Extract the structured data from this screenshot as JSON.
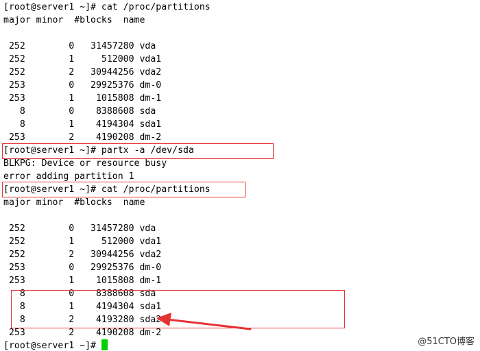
{
  "terminal": {
    "lines": [
      "[root@server1 ~]# cat /proc/partitions",
      "major minor  #blocks  name",
      "",
      " 252        0   31457280 vda",
      " 252        1     512000 vda1",
      " 252        2   30944256 vda2",
      " 253        0   29925376 dm-0",
      " 253        1    1015808 dm-1",
      "   8        0    8388608 sda",
      "   8        1    4194304 sda1",
      " 253        2    4190208 dm-2",
      "[root@server1 ~]# partx -a /dev/sda",
      "BLKPG: Device or resource busy",
      "error adding partition 1",
      "[root@server1 ~]# cat /proc/partitions",
      "major minor  #blocks  name",
      "",
      " 252        0   31457280 vda",
      " 252        1     512000 vda1",
      " 252        2   30944256 vda2",
      " 253        0   29925376 dm-0",
      " 253        1    1015808 dm-1",
      "   8        0    8388608 sda",
      "   8        1    4194304 sda1",
      "   8        2    4193280 sda2",
      " 253        2    4190208 dm-2",
      "[root@server1 ~]# "
    ]
  },
  "colors": {
    "background": "#ffffff",
    "text": "#000000",
    "highlight_box": "#e63232",
    "arrow": "#e63232",
    "cursor": "#00d000"
  },
  "watermark": {
    "text": "@51CTO博客"
  }
}
